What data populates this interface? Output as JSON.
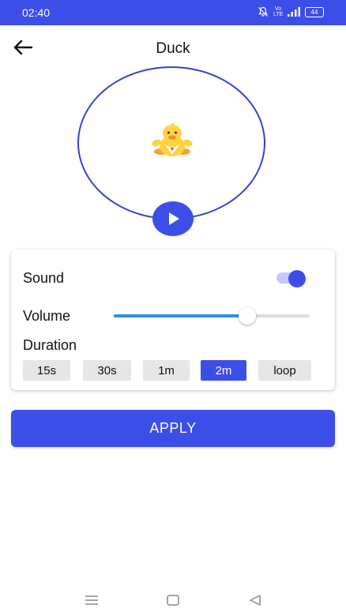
{
  "status_bar": {
    "time": "02:40",
    "network_label": "Vo LTE",
    "battery": "44"
  },
  "header": {
    "title": "Duck"
  },
  "settings": {
    "sound_label": "Sound",
    "sound_on": true,
    "volume_label": "Volume",
    "volume_level": 0.68,
    "duration_label": "Duration",
    "durations": [
      {
        "label": "15s",
        "selected": false
      },
      {
        "label": "30s",
        "selected": false
      },
      {
        "label": "1m",
        "selected": false
      },
      {
        "label": "2m",
        "selected": true
      },
      {
        "label": "loop",
        "selected": false
      }
    ]
  },
  "apply_label": "APPLY",
  "colors": {
    "accent": "#3c4ee8",
    "status_bar": "#3c4ee8",
    "slider_fill": "#2f8fe8",
    "chip_bg": "#e6e6e6"
  },
  "icons": [
    "back-arrow-icon",
    "duck-icon",
    "play-icon",
    "mute-bell-icon",
    "signal-icon",
    "battery-icon",
    "menu-icon",
    "home-icon",
    "back-triangle-icon"
  ]
}
